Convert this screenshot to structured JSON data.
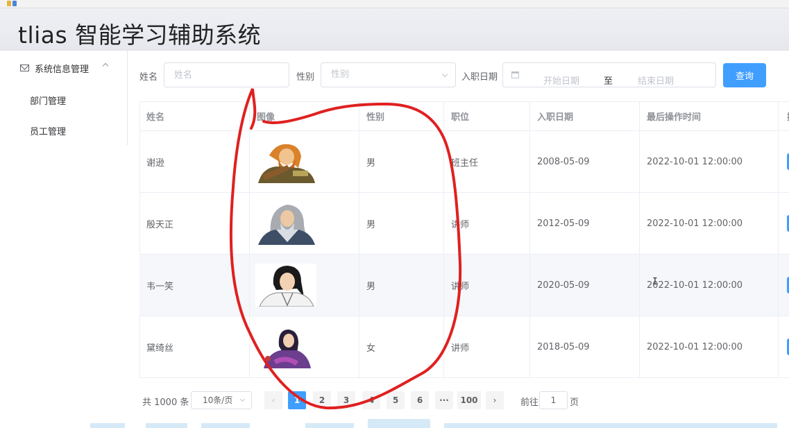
{
  "app": {
    "title": "tlias 智能学习辅助系统"
  },
  "sidebar": {
    "group_label": "系统信息管理",
    "items": [
      {
        "label": "部门管理"
      },
      {
        "label": "员工管理"
      }
    ]
  },
  "search": {
    "name_label": "姓名",
    "name_placeholder": "姓名",
    "gender_label": "性别",
    "gender_placeholder": "性别",
    "date_label": "入职日期",
    "start_placeholder": "开始日期",
    "range_separator": "至",
    "end_placeholder": "结束日期",
    "query_button": "查询"
  },
  "table": {
    "headers": [
      "姓名",
      "图像",
      "性别",
      "职位",
      "入职日期",
      "最后操作时间"
    ],
    "rows": [
      {
        "name": "谢逊",
        "gender": "男",
        "position": "班主任",
        "entry_date": "2008-05-09",
        "update_time": "2022-10-01 12:00:00",
        "avatar": "orange-haired-bearded-warrior-avatar"
      },
      {
        "name": "殷天正",
        "gender": "男",
        "position": "讲师",
        "entry_date": "2012-05-09",
        "update_time": "2022-10-01 12:00:00",
        "avatar": "white-haired-elder-avatar"
      },
      {
        "name": "韦一笑",
        "gender": "男",
        "position": "讲师",
        "entry_date": "2020-05-09",
        "update_time": "2022-10-01 12:00:00",
        "avatar": "black-haired-swordsman-avatar"
      },
      {
        "name": "黛绮丝",
        "gender": "女",
        "position": "讲师",
        "entry_date": "2018-05-09",
        "update_time": "2022-10-01 12:00:00",
        "avatar": "purple-robed-woman-avatar"
      }
    ]
  },
  "pagination": {
    "total": "共 1000 条",
    "page_size": "10条/页",
    "pages": [
      "1",
      "2",
      "3",
      "4",
      "5",
      "6",
      "···",
      "100"
    ],
    "current": "1",
    "goto_label": "前往",
    "goto_value": "1",
    "page_suffix": "页"
  },
  "colors": {
    "primary": "#409eff",
    "annotation": "#e02020"
  }
}
